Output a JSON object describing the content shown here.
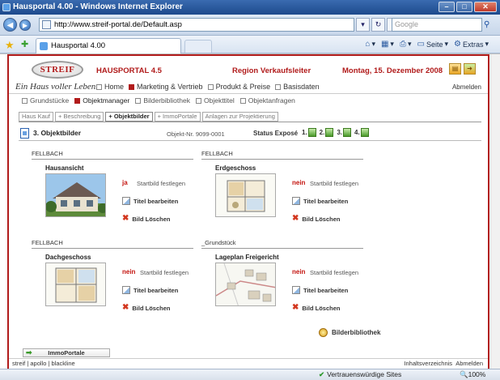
{
  "browser": {
    "title": "Hausportal 4.00 - Windows Internet Explorer",
    "url": "http://www.streif-portal.de/Default.asp",
    "search_placeholder": "Google",
    "tab_label": "Hausportal 4.00",
    "cmd_page": "Seite",
    "cmd_extras": "Extras",
    "status_trusted": "Vertrauenswürdige Sites",
    "zoom": "100%"
  },
  "site": {
    "logo": "STREIF",
    "tagline": "Ein Haus voller Leben.",
    "portal": "HAUSPORTAL 4.5",
    "region": "Region Verkaufsleiter",
    "date": "Montag, 15. Dezember 2008",
    "logout": "Abmelden",
    "nav": [
      {
        "label": "Home",
        "active": false
      },
      {
        "label": "Marketing & Vertrieb",
        "active": true
      },
      {
        "label": "Produkt & Preise",
        "active": false
      },
      {
        "label": "Basisdaten",
        "active": false
      }
    ],
    "subnav": [
      {
        "label": "Grundstücke",
        "active": false
      },
      {
        "label": "Objektmanager",
        "active": true
      },
      {
        "label": "Bilderbibliothek",
        "active": false
      },
      {
        "label": "Objekttitel",
        "active": false
      },
      {
        "label": "Objektanfragen",
        "active": false
      }
    ],
    "tabs": [
      "Haus Kauf",
      "+ Beschreibung",
      "+ Objektbilder",
      "+ ImmoPortale",
      "Anlagen zur Projektierung"
    ],
    "active_tab": 2
  },
  "section": {
    "title": "3. Objektbilder",
    "objekt_nr_label": "Objekt-Nr.",
    "objekt_nr": "9099-0001",
    "status_label": "Status Exposé",
    "expose": [
      "1.",
      "2.",
      "3.",
      "4."
    ]
  },
  "cards": [
    {
      "group": "FELLBACH",
      "name": "Hausansicht",
      "startbild": "ja",
      "startbild_label": "Startbild festlegen",
      "edit_label": "Titel bearbeiten",
      "delete_label": "Bild Löschen"
    },
    {
      "group": "FELLBACH",
      "name": "Erdgeschoss",
      "startbild": "nein",
      "startbild_label": "Startbild festlegen",
      "edit_label": "Titel bearbeiten",
      "delete_label": "Bild Löschen"
    },
    {
      "group": "FELLBACH",
      "name": "Dachgeschoss",
      "startbild": "nein",
      "startbild_label": "Startbild festlegen",
      "edit_label": "Titel bearbeiten",
      "delete_label": "Bild Löschen"
    },
    {
      "group": "_Grundstück",
      "name": "Lageplan Freigericht",
      "startbild": "nein",
      "startbild_label": "Startbild festlegen",
      "edit_label": "Titel bearbeiten",
      "delete_label": "Bild Löschen"
    }
  ],
  "bibliothek": "Bilderbibliothek",
  "immoportale": "ImmoPortale",
  "footer": {
    "left": "streif | apollo | blackline",
    "right_index": "Inhaltsverzeichnis",
    "right_logout": "Abmelden"
  }
}
